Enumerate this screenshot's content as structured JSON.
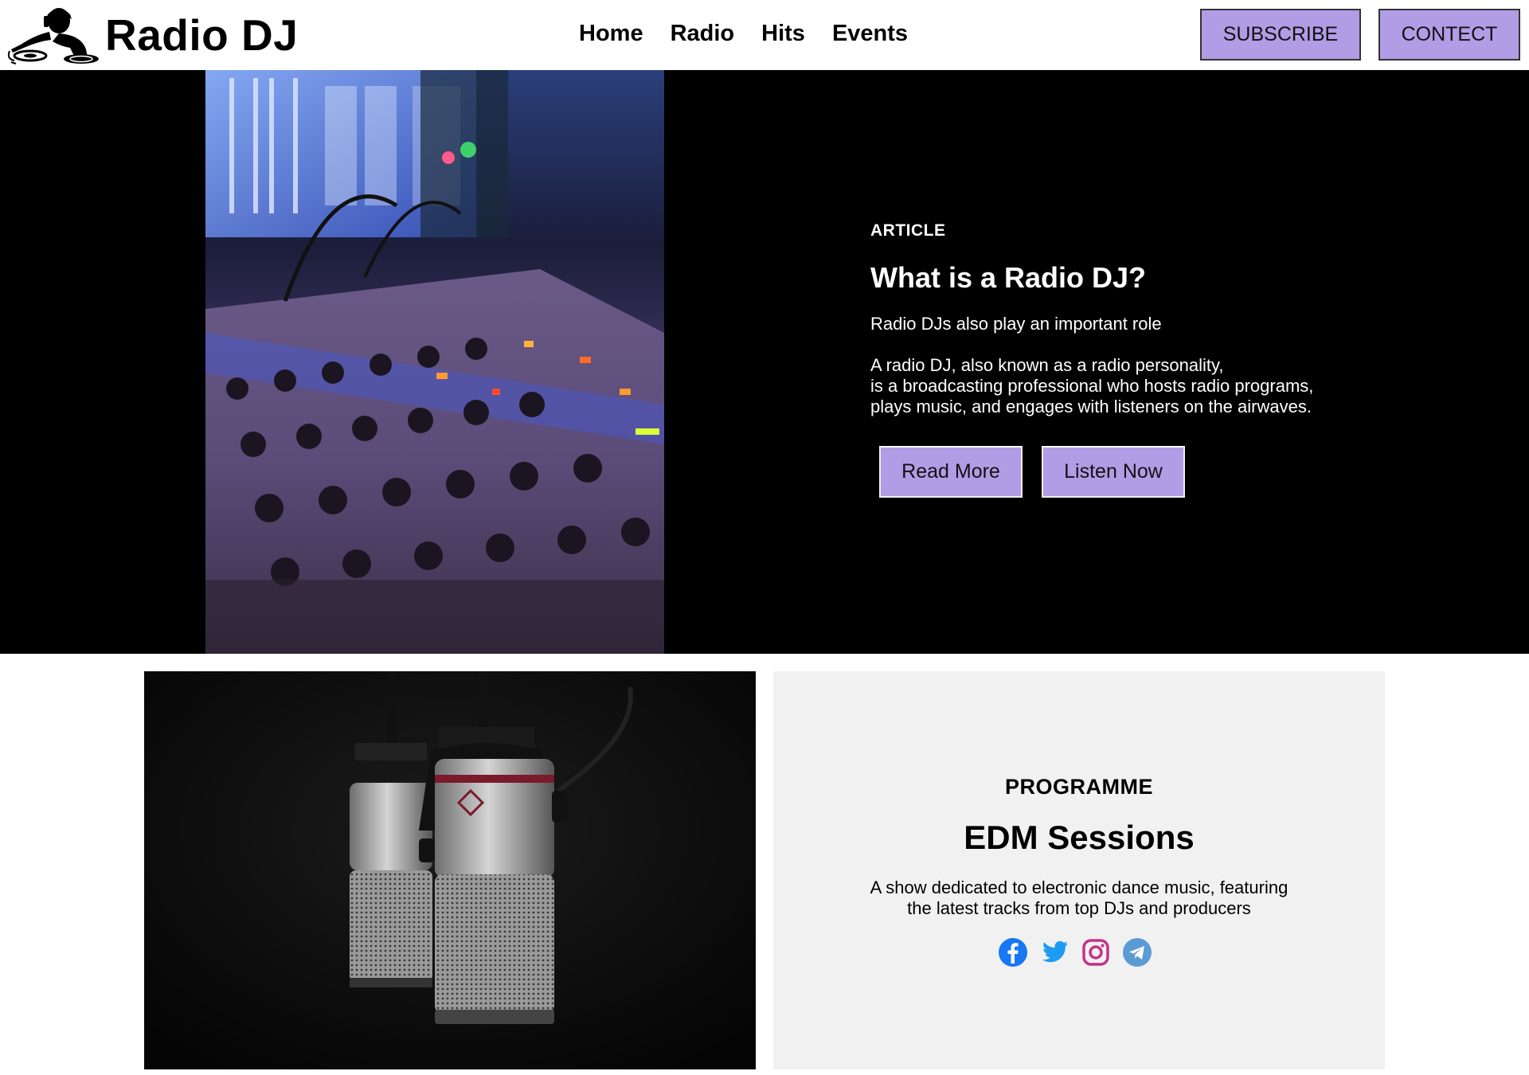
{
  "brand": {
    "name": "Radio DJ"
  },
  "nav": {
    "items": [
      {
        "label": "Home"
      },
      {
        "label": "Radio"
      },
      {
        "label": "Hits"
      },
      {
        "label": "Events"
      }
    ]
  },
  "header_actions": {
    "subscribe_label": "SUBSCRIBE",
    "contact_label": "CONTECT"
  },
  "hero": {
    "kicker": "ARTICLE",
    "title": "What is a Radio DJ?",
    "subtitle": "Radio DJs also play an important role",
    "body": "A radio DJ, also known as a radio personality,\nis a broadcasting professional who hosts radio programs,\nplays music, and engages with listeners on the airwaves.",
    "read_more_label": "Read More",
    "listen_now_label": "Listen Now"
  },
  "programme": {
    "kicker": "PROGRAMME",
    "title": "EDM Sessions",
    "description": "A show dedicated to electronic dance music, featuring\nthe latest tracks from top DJs and producers",
    "social": [
      "facebook-icon",
      "twitter-icon",
      "instagram-icon",
      "telegram-icon"
    ]
  },
  "colors": {
    "accent": "#b19ce6",
    "hero_bg": "#000000",
    "card_bg": "#f1f1f1",
    "facebook": "#1877f2",
    "twitter": "#1d9bf0",
    "instagram": "#c13584",
    "telegram": "#5b9bd5"
  }
}
